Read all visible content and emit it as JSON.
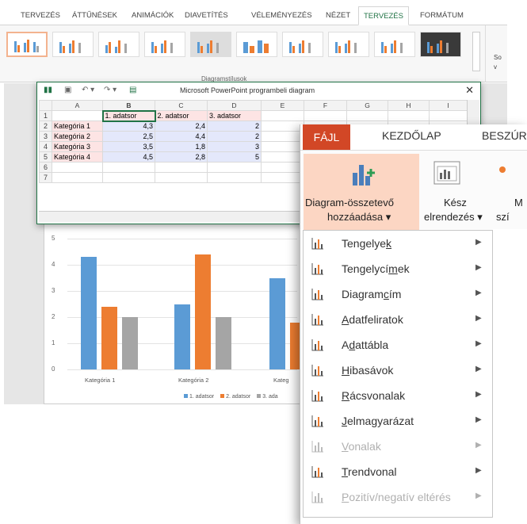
{
  "ppt_tabs": [
    "TERVEZÉS",
    "ÁTTŰNÉSEK",
    "ANIMÁCIÓK",
    "DIAVETÍTÉS",
    "VÉLEMÉNYEZÉS",
    "NÉZET",
    "TERVEZÉS",
    "FORMÁTUM"
  ],
  "ribbon": {
    "group_label": "Diagramstílusok",
    "right_1": "So",
    "right_2": "v"
  },
  "sheet": {
    "title": "Microsoft PowerPoint programbeli  diagram",
    "close": "✕",
    "col_headers": [
      "A",
      "B",
      "C",
      "D",
      "E",
      "F",
      "G",
      "H",
      "I"
    ],
    "rows": [
      {
        "n": "1",
        "cells": [
          "",
          "1. adatsor",
          "2. adatsor",
          "3. adatsor",
          "",
          "",
          "",
          "",
          ""
        ]
      },
      {
        "n": "2",
        "cells": [
          "Kategória 1",
          "4,3",
          "2,4",
          "2",
          "",
          "",
          "",
          "",
          ""
        ]
      },
      {
        "n": "3",
        "cells": [
          "Kategória 2",
          "2,5",
          "4,4",
          "2",
          "",
          "",
          "",
          "",
          ""
        ]
      },
      {
        "n": "4",
        "cells": [
          "Kategória 3",
          "3,5",
          "1,8",
          "3",
          "",
          "",
          "",
          "",
          ""
        ]
      },
      {
        "n": "5",
        "cells": [
          "Kategória 4",
          "4,5",
          "2,8",
          "5",
          "",
          "",
          "",
          "",
          ""
        ]
      },
      {
        "n": "6",
        "cells": [
          "",
          "",
          "",
          "",
          "",
          "",
          "",
          "",
          ""
        ]
      },
      {
        "n": "7",
        "cells": [
          "",
          "",
          "",
          "",
          "",
          "",
          "",
          "",
          ""
        ]
      }
    ]
  },
  "chart_data": {
    "type": "bar",
    "categories": [
      "Kategória 1",
      "Kategória 2",
      "Kategória 3",
      "Kategória 4"
    ],
    "series": [
      {
        "name": "1. adatsor",
        "values": [
          4.3,
          2.5,
          3.5,
          4.5
        ],
        "color": "#5b9bd5"
      },
      {
        "name": "2. adatsor",
        "values": [
          2.4,
          4.4,
          1.8,
          2.8
        ],
        "color": "#ed7d31"
      },
      {
        "name": "3. adatsor",
        "values": [
          2,
          2,
          3,
          5
        ],
        "color": "#a5a5a5"
      }
    ],
    "ylim": [
      0,
      5
    ],
    "yticks": [
      "0",
      "1",
      "2",
      "3",
      "4",
      "5"
    ],
    "legend": "bottom",
    "visible_x_labels": [
      "Kategória 1",
      "Kategória 2",
      "Kateg"
    ],
    "visible_legend": [
      "1. adatsor",
      "2. adatsor",
      "3. ada"
    ]
  },
  "word": {
    "tabs": {
      "file": "FÁJL",
      "home": "KEZDŐLAP",
      "insert": "BESZÚR"
    },
    "add_element": {
      "line1": "Diagram-összetevő",
      "line2": "hozzáadása ▾"
    },
    "quick_layout": {
      "line1": "Kész",
      "line2": "elrendezés ▾"
    },
    "colors": {
      "line1": "M",
      "line2": "szí"
    }
  },
  "menu": [
    {
      "pre": "Tengelye",
      "acc": "k",
      "post": "",
      "disabled": false,
      "icon": "axes-icon"
    },
    {
      "pre": "Tengelycí",
      "acc": "m",
      "post": "ek",
      "disabled": false,
      "icon": "axis-titles-icon"
    },
    {
      "pre": "Diagram",
      "acc": "c",
      "post": "ím",
      "disabled": false,
      "icon": "chart-title-icon"
    },
    {
      "pre": "",
      "acc": "A",
      "post": "datfeliratok",
      "disabled": false,
      "icon": "data-labels-icon"
    },
    {
      "pre": "A",
      "acc": "d",
      "post": "attábla",
      "disabled": false,
      "icon": "data-table-icon"
    },
    {
      "pre": "",
      "acc": "H",
      "post": "ibasávok",
      "disabled": false,
      "icon": "error-bars-icon"
    },
    {
      "pre": "",
      "acc": "R",
      "post": "ácsvonalak",
      "disabled": false,
      "icon": "gridlines-icon"
    },
    {
      "pre": "",
      "acc": "J",
      "post": "elmagyarázat",
      "disabled": false,
      "icon": "legend-icon"
    },
    {
      "pre": "",
      "acc": "V",
      "post": "onalak",
      "disabled": true,
      "icon": "lines-icon"
    },
    {
      "pre": "",
      "acc": "T",
      "post": "rendvonal",
      "disabled": false,
      "icon": "trendline-icon"
    },
    {
      "pre": "",
      "acc": "P",
      "post": "ozitív/negatív eltérés",
      "disabled": true,
      "icon": "up-down-bars-icon"
    }
  ]
}
